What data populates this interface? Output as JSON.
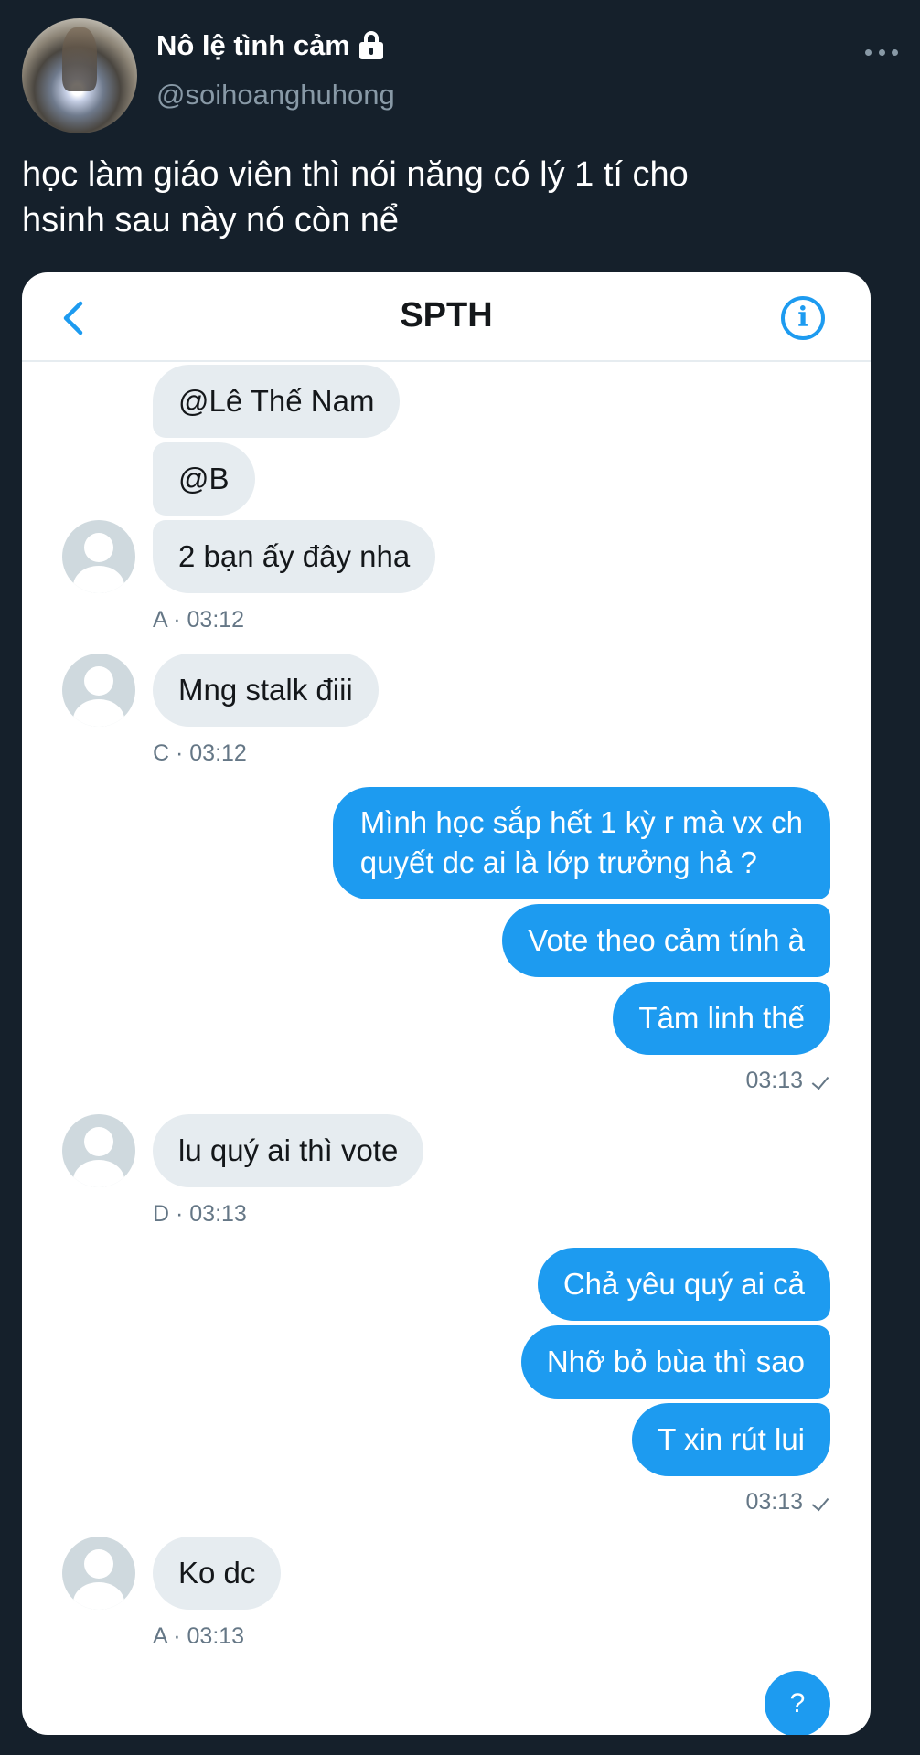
{
  "tweet": {
    "display_name": "Nô lệ tình cảm",
    "handle": "@soihoanghuhong",
    "text_line1": "học làm giáo viên thì nói năng có lý 1 tí cho",
    "text_line2": "hsinh sau này nó còn nể",
    "protected_icon": "lock-icon",
    "more_icon": "more-dots-icon"
  },
  "chat": {
    "title": "SPTH",
    "back_icon": "chevron-left-icon",
    "info_icon": "info-icon",
    "info_glyph": "i",
    "help_label": "?",
    "messages": [
      {
        "dir": "in",
        "text": "@Lê Thế Nam"
      },
      {
        "dir": "in",
        "text": "@B"
      },
      {
        "dir": "in",
        "text": "2 bạn ấy đây nha"
      },
      {
        "dir": "in",
        "text": "Mng stalk điii"
      },
      {
        "dir": "out",
        "line1": "Mình học sắp hết 1 kỳ r mà vx ch",
        "line2": "quyết dc ai là lớp trưởng hả ?"
      },
      {
        "dir": "out",
        "text": "Vote theo cảm tính à"
      },
      {
        "dir": "out",
        "text": "Tâm linh thế"
      },
      {
        "dir": "in",
        "text": "lu quý ai thì vote"
      },
      {
        "dir": "out",
        "text": "Chả yêu quý ai cả"
      },
      {
        "dir": "out",
        "text": "Nhỡ bỏ bùa thì sao"
      },
      {
        "dir": "out",
        "text": "T xin rút lui"
      },
      {
        "dir": "in",
        "text": "Ko dc"
      }
    ],
    "meta": [
      "A · 03:12",
      "C · 03:12",
      "03:13",
      "D · 03:13",
      "03:13",
      "A · 03:13"
    ]
  },
  "colors": {
    "background": "#15202b",
    "accent": "#1d9bf0",
    "incoming_bubble": "#e6ecf0",
    "muted": "#8899a6"
  }
}
